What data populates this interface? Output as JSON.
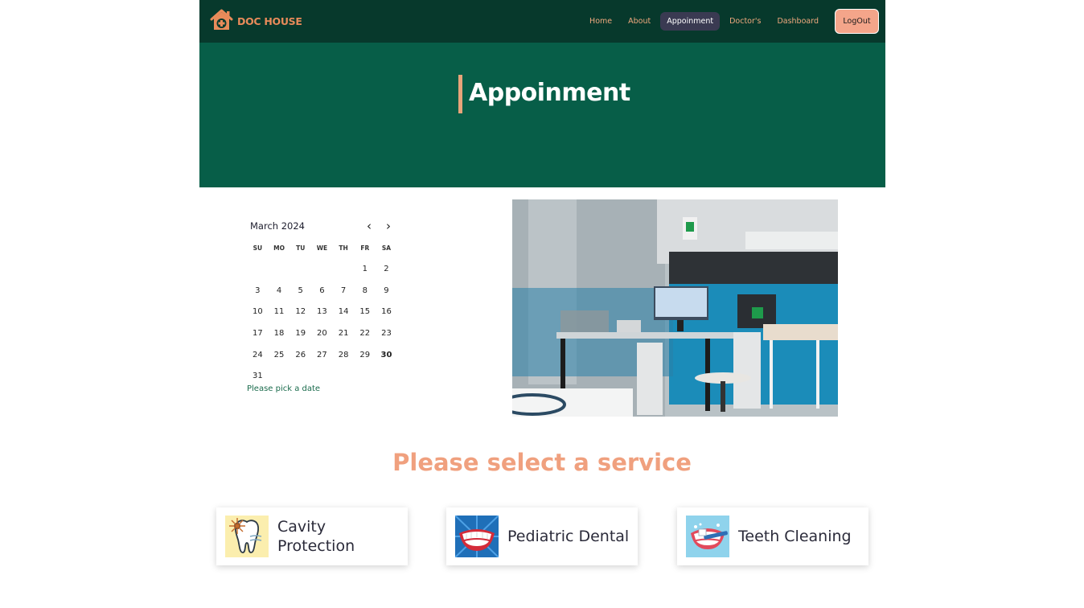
{
  "nav": {
    "brand": "DOC HOUSE",
    "links": [
      "Home",
      "About",
      "Appoinment",
      "Doctor's",
      "Dashboard"
    ],
    "active_index": 2,
    "logout_label": "LogOut"
  },
  "hero": {
    "title": "Appoinment"
  },
  "calendar": {
    "month_label": "March 2024",
    "weekdays": [
      "SU",
      "MO",
      "TU",
      "WE",
      "TH",
      "FR",
      "SA"
    ],
    "days": [
      "",
      "",
      "",
      "",
      "",
      "1",
      "2",
      "3",
      "4",
      "5",
      "6",
      "7",
      "8",
      "9",
      "10",
      "11",
      "12",
      "13",
      "14",
      "15",
      "16",
      "17",
      "18",
      "19",
      "20",
      "21",
      "22",
      "23",
      "24",
      "25",
      "26",
      "27",
      "28",
      "29",
      "30",
      "31"
    ],
    "today": "30",
    "hint": "Please pick a date"
  },
  "services": {
    "title": "Please select a service",
    "items": [
      {
        "name": "Cavity Protection",
        "icon": "tooth-icon"
      },
      {
        "name": "Pediatric Dental",
        "icon": "smile-icon"
      },
      {
        "name": "Teeth Cleaning",
        "icon": "toothbrush-icon"
      }
    ]
  },
  "colors": {
    "nav_bg": "#07392c",
    "hero_bg": "#075e48",
    "accent": "#f0a07e",
    "logout_bg": "#f4a58a"
  }
}
